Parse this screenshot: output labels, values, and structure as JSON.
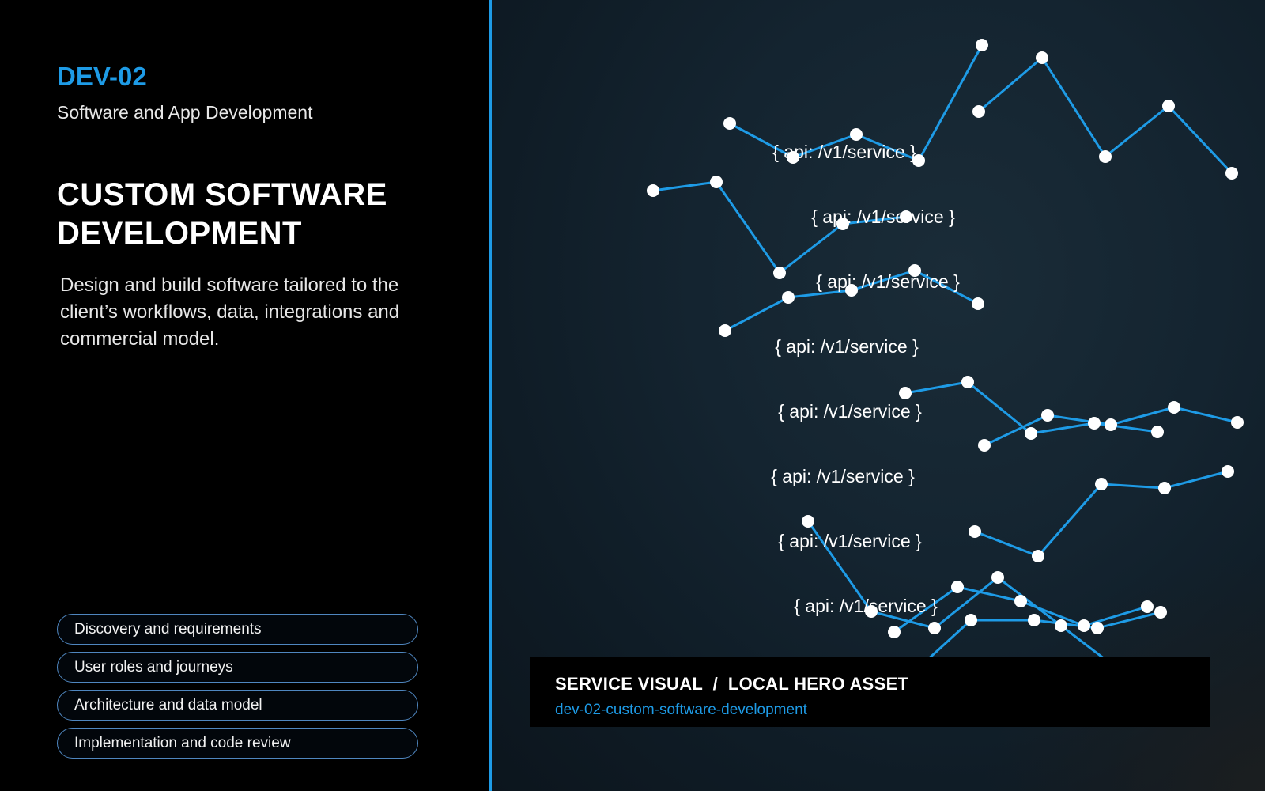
{
  "service": {
    "code": "DEV-02",
    "category": "Software and App Development",
    "title_lines": [
      "CUSTOM SOFTWARE",
      "DEVELOPMENT"
    ],
    "description": "Design and build software tailored to the client’s workflows, data, integrations and commercial model."
  },
  "capabilities": [
    "Discovery and requirements",
    "User roles and journeys",
    "Architecture and data model",
    "Implementation and code review"
  ],
  "visual": {
    "api_labels": [
      "{ api: /v1/service }",
      "{ api: /v1/service }",
      "{ api: /v1/service }",
      "{ api: /v1/service }",
      "{ api: /v1/service }",
      "{ api: /v1/service }",
      "{ api: /v1/service }",
      "{ api: /v1/service }"
    ],
    "caption_title": "SERVICE VISUAL  /  LOCAL HERO ASSET",
    "caption_slug": "dev-02-custom-software-development"
  },
  "colors": {
    "accent": "#1e9be6",
    "background": "#000000",
    "visual_background": "#142430",
    "node": "#ffffff"
  }
}
